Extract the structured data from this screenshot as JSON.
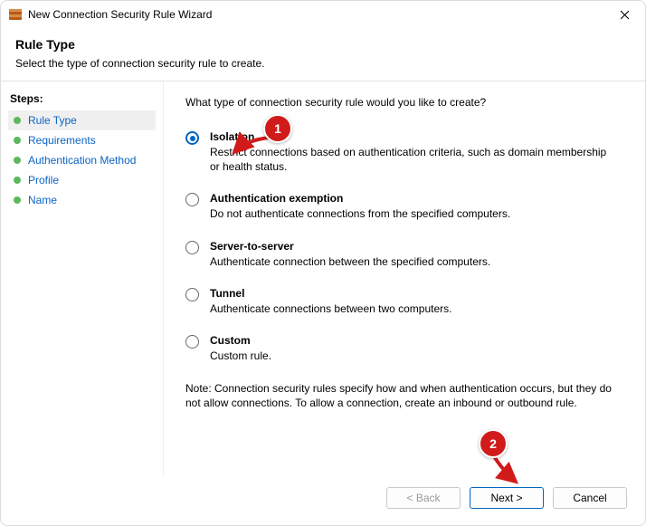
{
  "window": {
    "title": "New Connection Security Rule Wizard"
  },
  "header": {
    "title": "Rule Type",
    "subtitle": "Select the type of connection security rule to create."
  },
  "sidebar": {
    "heading": "Steps:",
    "items": [
      {
        "label": "Rule Type"
      },
      {
        "label": "Requirements"
      },
      {
        "label": "Authentication Method"
      },
      {
        "label": "Profile"
      },
      {
        "label": "Name"
      }
    ]
  },
  "content": {
    "question": "What type of connection security rule would you like to create?",
    "options": [
      {
        "label": "Isolation",
        "desc": "Restrict connections based on authentication criteria, such as domain membership or health status.",
        "selected": true
      },
      {
        "label": "Authentication exemption",
        "desc": "Do not authenticate connections from the specified computers."
      },
      {
        "label": "Server-to-server",
        "desc": "Authenticate connection between the specified computers."
      },
      {
        "label": "Tunnel",
        "desc": "Authenticate connections between two computers."
      },
      {
        "label": "Custom",
        "desc": "Custom rule."
      }
    ],
    "note": "Note:  Connection security rules specify how and when authentication occurs, but they do not allow connections.  To allow a connection, create an inbound or outbound rule."
  },
  "footer": {
    "back": "< Back",
    "next": "Next >",
    "cancel": "Cancel"
  },
  "annotations": {
    "a1": "1",
    "a2": "2"
  }
}
